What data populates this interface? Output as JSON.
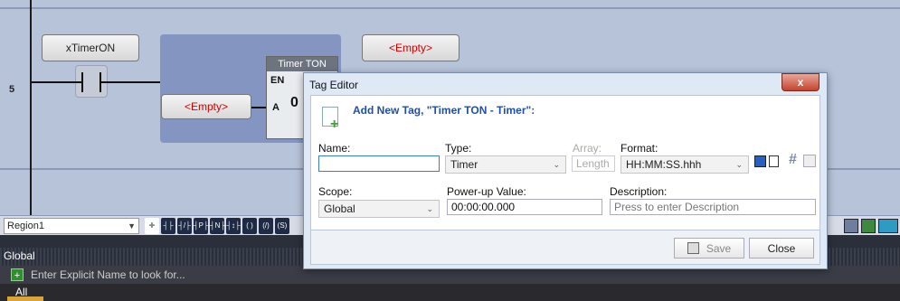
{
  "ladder": {
    "rung_number": "5",
    "contact_tag": "xTimerON",
    "output_tag": "<Empty>",
    "fb_input_tag": "<Empty>",
    "function_block": {
      "title": "Timer TON",
      "pin_en": "EN",
      "pin_a": "A",
      "value_display": "0"
    }
  },
  "toolbar": {
    "region": "Region1"
  },
  "bottom_panel": {
    "scope_label": "Global",
    "search_placeholder": "Enter Explicit Name to look for...",
    "tab_all": "All"
  },
  "dialog": {
    "title": "Tag Editor",
    "close_glyph": "x",
    "headline": "Add New Tag, \"Timer TON - Timer\":",
    "name_label": "Name:",
    "name_value": "",
    "type_label": "Type:",
    "type_value": "Timer",
    "array_label": "Array:",
    "array_placeholder": "Length",
    "format_label": "Format:",
    "format_value": "HH:MM:SS.hhh",
    "scope_label": "Scope:",
    "scope_value": "Global",
    "powerup_label": "Power-up Value:",
    "powerup_value": "00:00:00.000",
    "description_label": "Description:",
    "description_placeholder": "Press to enter Description",
    "save_label": "Save",
    "close_label": "Close"
  },
  "icons": {
    "hash": "#"
  }
}
